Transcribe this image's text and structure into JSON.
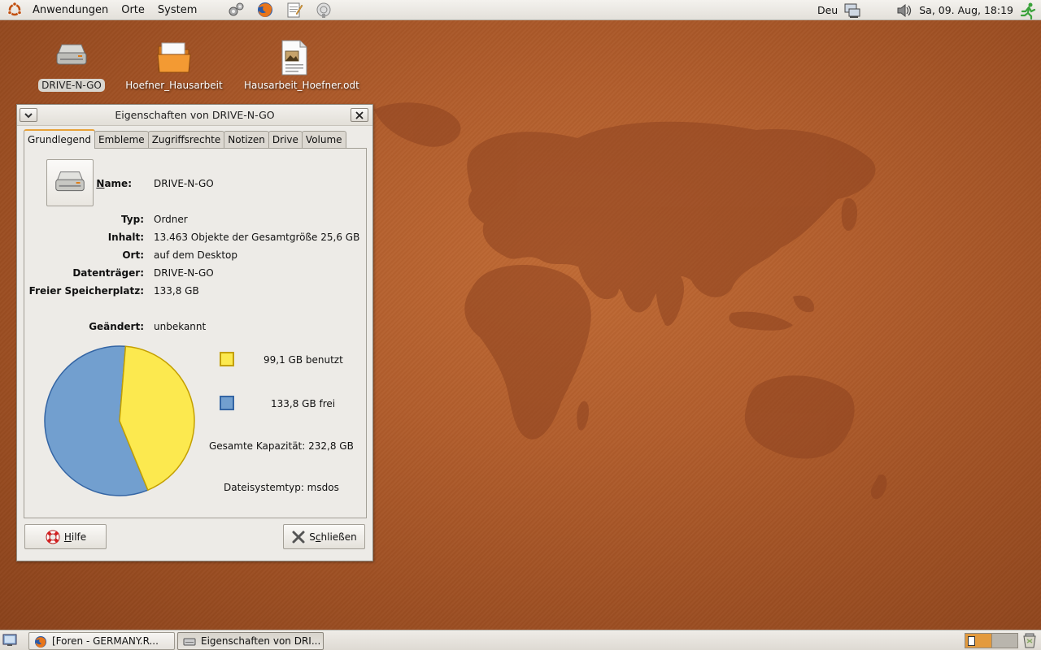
{
  "top_panel": {
    "menus": [
      "Anwendungen",
      "Orte",
      "System"
    ],
    "keyboard_layout": "Deu",
    "clock": "Sa, 09. Aug, 18:19"
  },
  "desktop": {
    "icons": [
      {
        "label": "DRIVE-N-GO",
        "icon": "drive-icon",
        "selected": true
      },
      {
        "label": "Hoefner_Hausarbeit",
        "icon": "folder-icon",
        "selected": false
      },
      {
        "label": "Hausarbeit_Hoefner.odt",
        "icon": "document-icon",
        "selected": false
      }
    ]
  },
  "dialog": {
    "title": "Eigenschaften von DRIVE-N-GO",
    "tabs": [
      "Grundlegend",
      "Embleme",
      "Zugriffsrechte",
      "Notizen",
      "Drive",
      "Volume"
    ],
    "active_tab": "Grundlegend",
    "name_label_mnemonic": "N",
    "name_label_rest": "ame:",
    "name_value": "DRIVE-N-GO",
    "properties": [
      {
        "label": "Typ:",
        "value": "Ordner"
      },
      {
        "label": "Inhalt:",
        "value": "13.463 Objekte der Gesamtgröße 25,6 GB"
      },
      {
        "label": "Ort:",
        "value": "auf dem Desktop"
      },
      {
        "label": "Datenträger:",
        "value": "DRIVE-N-GO"
      },
      {
        "label": "Freier Speicherplatz:",
        "value": "133,8 GB"
      }
    ],
    "modified": {
      "label": "Geändert:",
      "value": "unbekannt"
    },
    "usage": {
      "used_text": "99,1 GB benutzt",
      "free_text": "133,8 GB frei",
      "capacity_text": "Gesamte Kapazität: 232,8 GB",
      "fs_text": "Dateisystemtyp: msdos",
      "used_gb": 99.1,
      "free_gb": 133.8,
      "used_color": "#fce94f",
      "used_border": "#c4a000",
      "free_color": "#729fcf",
      "free_border": "#3465a4"
    },
    "help_button": {
      "mnemonic": "H",
      "rest": "ilfe"
    },
    "close_button": {
      "pre": "S",
      "mnemonic": "c",
      "rest": "hließen"
    }
  },
  "taskbar": {
    "tasks": [
      {
        "label": "[Foren - GERMANY.R...",
        "active": false
      },
      {
        "label": "Eigenschaften von DRI...",
        "active": true
      }
    ]
  },
  "colors": {
    "accent_tab": "#e8a23a",
    "desktop": "#b15d2c"
  }
}
